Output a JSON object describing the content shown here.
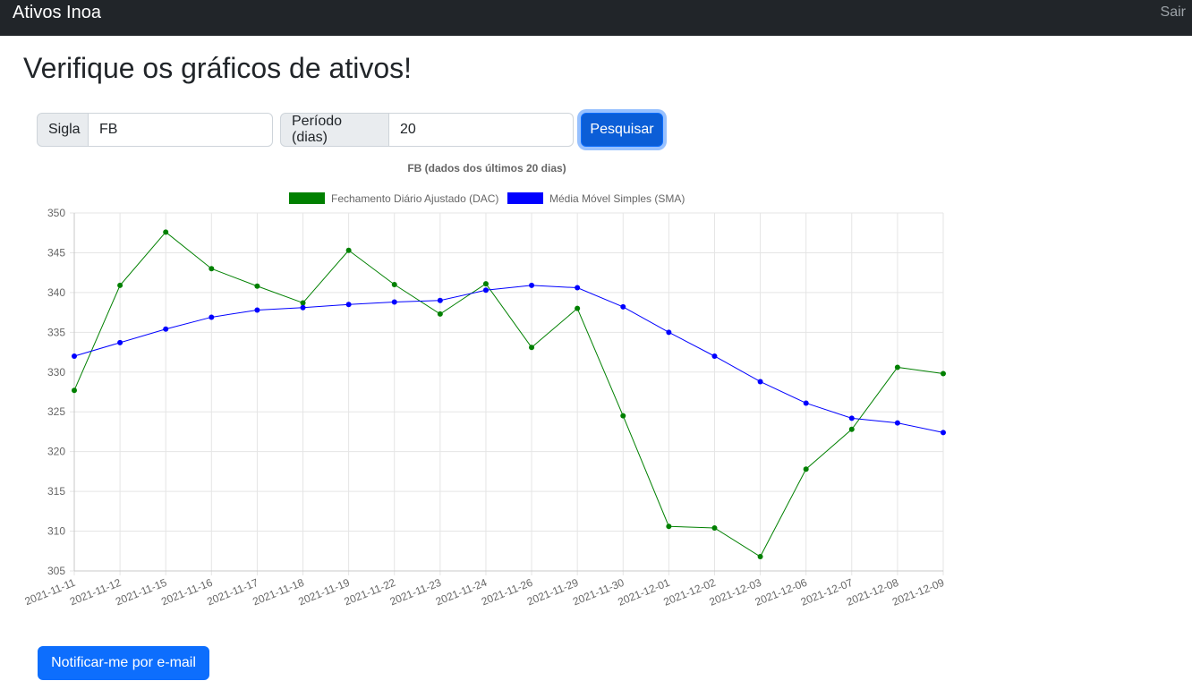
{
  "navbar": {
    "brand": "Ativos Inoa",
    "logout": "Sair"
  },
  "page": {
    "title": "Verifique os gráficos de ativos!"
  },
  "search": {
    "symbol_label": "Sigla",
    "symbol_value": "FB",
    "period_label": "Período (dias)",
    "period_value": "20",
    "submit_label": "Pesquisar"
  },
  "notify": {
    "label": "Notificar-me por e-mail"
  },
  "colors": {
    "dac": "#008000",
    "sma": "#0000ff",
    "primary": "#0d6efd",
    "navbar": "#212529"
  },
  "chart_data": {
    "type": "line",
    "title": "FB (dados dos últimos 20 dias)",
    "legend_position": "top",
    "grid": true,
    "categories": [
      "2021-11-11",
      "2021-11-12",
      "2021-11-15",
      "2021-11-16",
      "2021-11-17",
      "2021-11-18",
      "2021-11-19",
      "2021-11-22",
      "2021-11-23",
      "2021-11-24",
      "2021-11-26",
      "2021-11-29",
      "2021-11-30",
      "2021-12-01",
      "2021-12-02",
      "2021-12-03",
      "2021-12-06",
      "2021-12-07",
      "2021-12-08",
      "2021-12-09"
    ],
    "ylim": [
      305,
      350
    ],
    "yticks": [
      305,
      310,
      315,
      320,
      325,
      330,
      335,
      340,
      345,
      350
    ],
    "series": [
      {
        "name": "Fechamento Diário Ajustado (DAC)",
        "color": "#008000",
        "values": [
          327.7,
          340.9,
          347.6,
          343.0,
          340.8,
          338.7,
          345.3,
          341.0,
          337.3,
          341.1,
          333.1,
          338.0,
          324.5,
          310.6,
          310.4,
          306.8,
          317.8,
          322.8,
          330.6,
          329.8
        ]
      },
      {
        "name": "Média Móvel Simples (SMA)",
        "color": "#0000ff",
        "values": [
          332.0,
          333.7,
          335.4,
          336.9,
          337.8,
          338.1,
          338.5,
          338.8,
          339.0,
          340.3,
          340.9,
          340.6,
          338.2,
          335.0,
          332.0,
          328.8,
          326.1,
          324.2,
          323.6,
          322.4
        ]
      }
    ]
  }
}
